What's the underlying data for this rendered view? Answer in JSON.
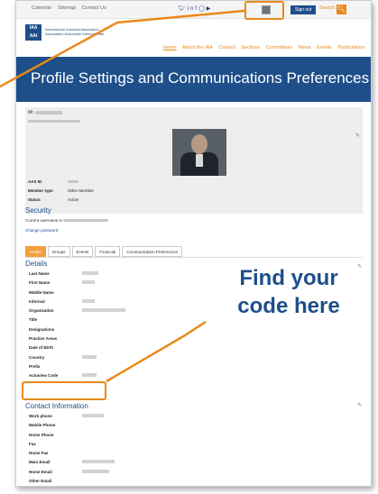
{
  "topbar": {
    "links": [
      "Calendar",
      "Sitemap",
      "Contact Us"
    ],
    "social_icons": [
      "twitter-icon",
      "linkedin-icon",
      "facebook-icon",
      "instagram-icon",
      "youtube-icon"
    ],
    "signout_label": "Sign out",
    "search_label": "Search"
  },
  "logo": {
    "mark": "IAA AAI",
    "line1": "International Actuarial Association",
    "line2": "Association Actuarielle Internationale"
  },
  "nav": {
    "items": [
      "Home",
      "About the IAA",
      "Council",
      "Sections",
      "Committees",
      "News",
      "Events",
      "Publications"
    ]
  },
  "page": {
    "title": "Profile Settings and Communications Preferences"
  },
  "profile": {
    "prefix": "Mr.",
    "fields": [
      {
        "label": "AAS ID",
        "value": ""
      },
      {
        "label": "Member type",
        "value": "Other Member"
      },
      {
        "label": "Status",
        "value": "Active"
      }
    ]
  },
  "security": {
    "title": "Security",
    "username_label": "Current username is",
    "change_password": "Change password"
  },
  "tabs": [
    "Profile",
    "Groups",
    "Events",
    "Financial",
    "Communication Preferences"
  ],
  "details": {
    "title": "Details",
    "fields": [
      "Last Name",
      "First Name",
      "Middle Name",
      "Informal",
      "Organization",
      "Title",
      "Designations",
      "Practice Areas",
      "Date of Birth",
      "Country",
      "Prefix",
      "Actuview Code"
    ]
  },
  "contact": {
    "title": "Contact Information",
    "fields": [
      "Work phone",
      "Mobile Phone",
      "Home Phone",
      "Fax",
      "Home Fax",
      "Main Email",
      "Home Email",
      "Other Email"
    ]
  },
  "callout": {
    "line1": "Find your",
    "line2": "code here"
  },
  "colors": {
    "brand_blue": "#1e4f8a",
    "accent_orange": "#e88a1a"
  }
}
